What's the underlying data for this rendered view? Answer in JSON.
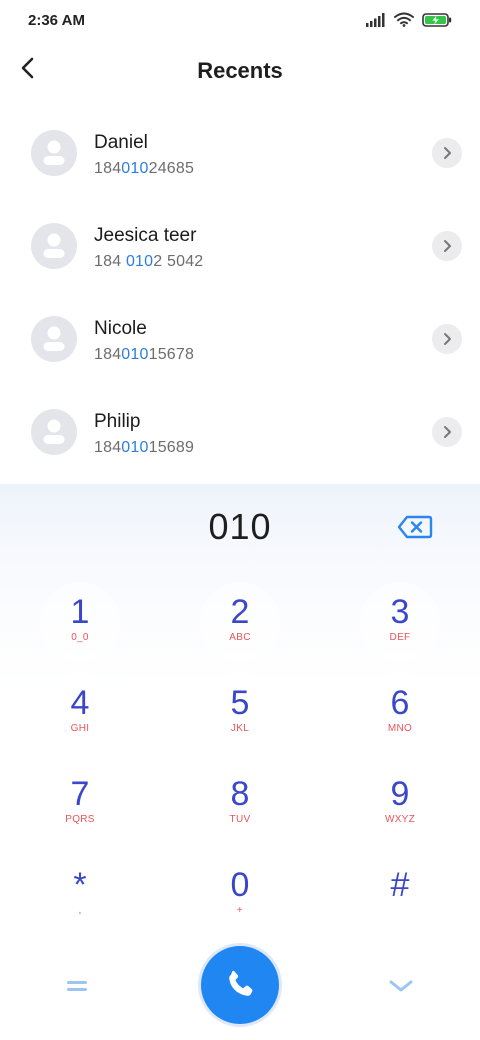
{
  "status_bar": {
    "time": "2:36 AM",
    "icons": [
      "signal-icon",
      "wifi-icon",
      "battery-charging-icon"
    ]
  },
  "header": {
    "title": "Recents",
    "back_icon": "back-arrow-icon"
  },
  "contacts": [
    {
      "name": "Daniel",
      "number_pre": "184",
      "number_match": "010",
      "number_post": "24685"
    },
    {
      "name": "Jeesica teer",
      "number_pre": "184 ",
      "number_match": "010",
      "number_post": "2 5042"
    },
    {
      "name": "Nicole",
      "number_pre": "184",
      "number_match": "010",
      "number_post": "15678"
    },
    {
      "name": "Philip",
      "number_pre": "184",
      "number_match": "010",
      "number_post": "15689"
    }
  ],
  "dialpad": {
    "display": "010",
    "keys": [
      {
        "digit": "1",
        "letters": "0_0"
      },
      {
        "digit": "2",
        "letters": "ABC"
      },
      {
        "digit": "3",
        "letters": "DEF"
      },
      {
        "digit": "4",
        "letters": "GHI"
      },
      {
        "digit": "5",
        "letters": "JKL"
      },
      {
        "digit": "6",
        "letters": "MNO"
      },
      {
        "digit": "7",
        "letters": "PQRS"
      },
      {
        "digit": "8",
        "letters": "TUV"
      },
      {
        "digit": "9",
        "letters": "WXYZ"
      },
      {
        "digit": "*",
        "letters": ","
      },
      {
        "digit": "0",
        "letters": "+"
      },
      {
        "digit": "#",
        "letters": ""
      }
    ]
  },
  "colors": {
    "accent_blue": "#1f86f2",
    "digit_blue": "#3a47c9",
    "letters_red": "#e8545c",
    "highlight_blue": "#2a7ee6",
    "avatar_gray": "#e3e5ea"
  }
}
